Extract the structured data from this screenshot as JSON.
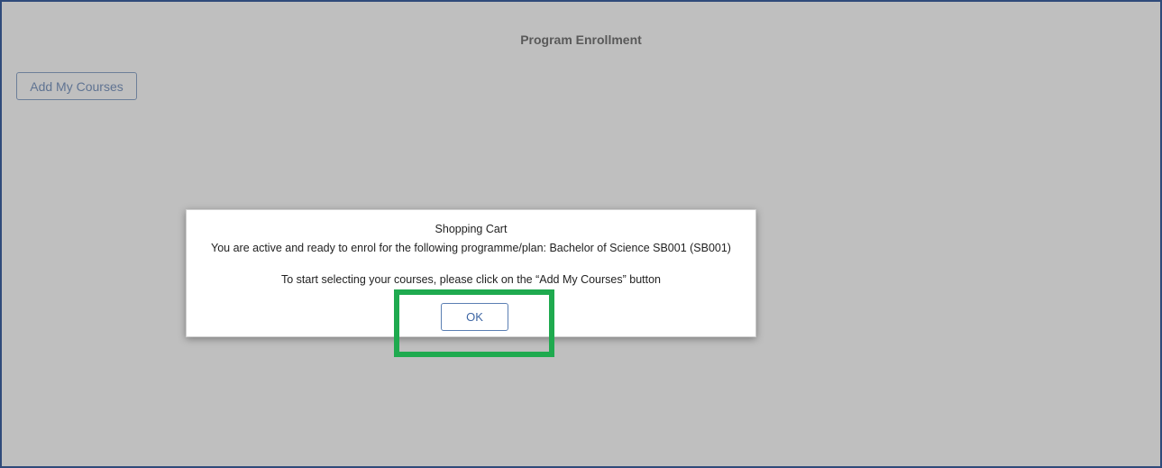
{
  "page": {
    "title": "Program Enrollment"
  },
  "toolbar": {
    "add_courses_label": "Add My Courses"
  },
  "dialog": {
    "title": "Shopping Cart",
    "message": "You are active and ready to enrol for the following programme/plan: Bachelor of Science SB001 (SB001)",
    "instruction": "To start selecting your courses, please click on the “Add My Courses” button",
    "ok_label": "OK"
  },
  "colors": {
    "frame_border": "#2f4a7a",
    "button_text": "#3e66a4",
    "highlight": "#1faa4f"
  }
}
